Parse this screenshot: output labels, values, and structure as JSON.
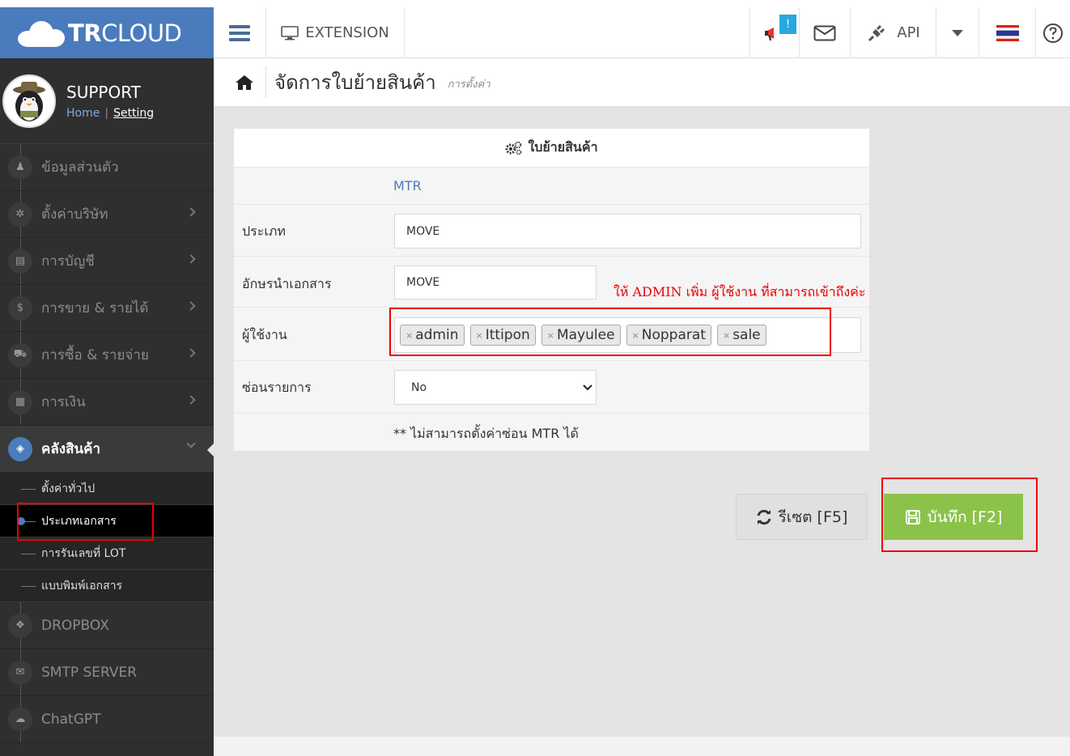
{
  "brand": {
    "name_bold": "TR",
    "name_light": "CLOUD"
  },
  "profile": {
    "name": "SUPPORT",
    "home_link": "Home",
    "setting_link": "Setting"
  },
  "sidebar": {
    "items": [
      {
        "label": "ข้อมูลส่วนตัว",
        "icon": "user-icon",
        "glyph": "♟"
      },
      {
        "label": "ตั้งค่าบริษัท",
        "icon": "gear-icon",
        "glyph": "✲"
      },
      {
        "label": "การบัญชี",
        "icon": "book-icon",
        "glyph": "▤"
      },
      {
        "label": "การขาย & รายได้",
        "icon": "dollar-icon",
        "glyph": "$"
      },
      {
        "label": "การซื้อ & รายจ่าย",
        "icon": "cart-icon",
        "glyph": "⛟"
      },
      {
        "label": "การเงิน",
        "icon": "calendar-icon",
        "glyph": "▦"
      },
      {
        "label": "คลังสินค้า",
        "icon": "box-icon",
        "glyph": "◈"
      }
    ],
    "subitems": [
      {
        "label": "ตั้งค่าทั่วไป"
      },
      {
        "label": "ประเภทเอกสาร"
      },
      {
        "label": "การรันเลขที่ LOT"
      },
      {
        "label": "แบบพิมพ์เอกสาร"
      }
    ],
    "bottom_items": [
      {
        "label": "DROPBOX",
        "icon": "dropbox-icon",
        "glyph": "❖"
      },
      {
        "label": "SMTP SERVER",
        "icon": "envelope-icon",
        "glyph": "✉"
      },
      {
        "label": "ChatGPT",
        "icon": "chat-icon",
        "glyph": "☁"
      }
    ]
  },
  "header": {
    "extension_label": "EXTENSION",
    "notify_badge": "!",
    "api_label": "API"
  },
  "page": {
    "title": "จัดการใบย้ายสินค้า",
    "subtitle": "การตั้งค่า"
  },
  "form": {
    "title": "ใบย้ายสินค้า",
    "code": "MTR",
    "type_label": "ประเภท",
    "type_value": "MOVE",
    "prefix_label": "อักษรนำเอกสาร",
    "prefix_value": "MOVE",
    "users_label": "ผู้ใช้งาน",
    "users": [
      "admin",
      "Ittipon",
      "Mayulee",
      "Nopparat",
      "sale"
    ],
    "hide_label": "ซ่อนรายการ",
    "hide_value": "No",
    "note": "** ไม่สามารถตั้งค่าซ่อน MTR ได้"
  },
  "annotation": "ให้ ADMIN เพิ่ม ผู้ใช้งาน ที่สามารถเข้าถึงค่ะ",
  "buttons": {
    "reset": "รีเซต [F5]",
    "save": "บันทึก [F2]"
  },
  "colors": {
    "brand": "#4a7bbd",
    "save": "#8bc34a",
    "annotation": "#ee0000"
  }
}
